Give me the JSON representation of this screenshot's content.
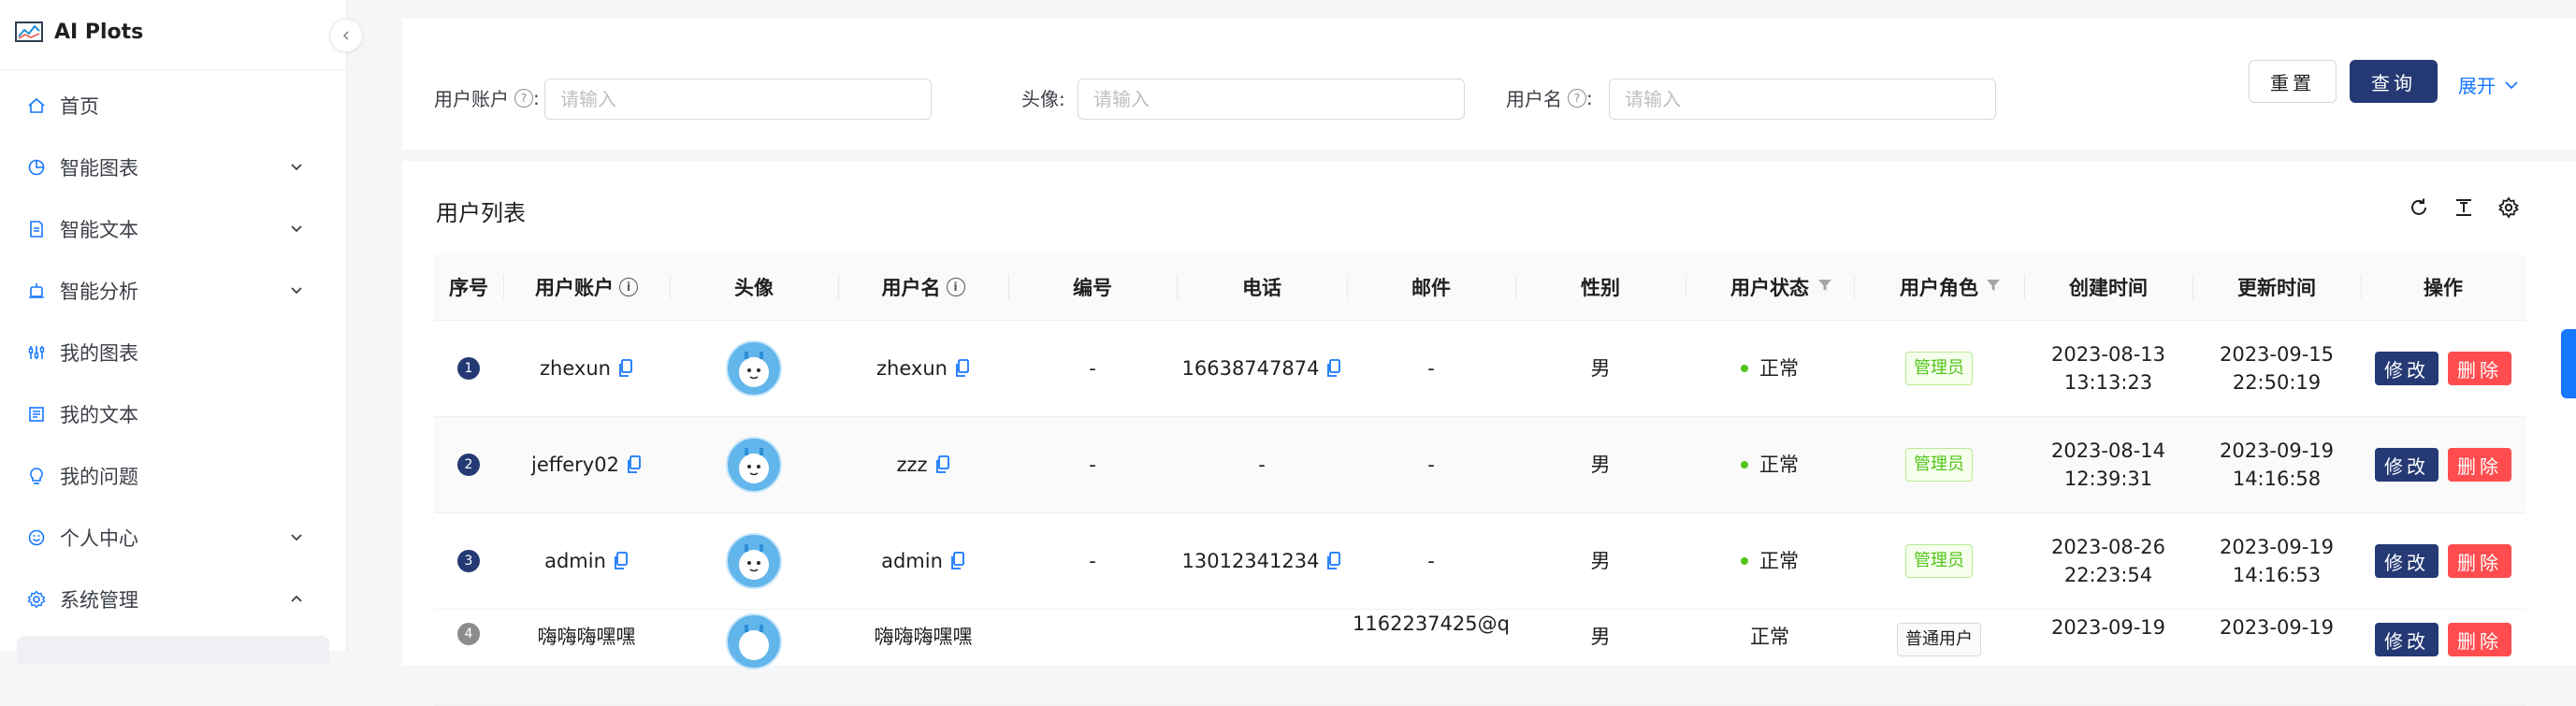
{
  "app": {
    "title": "AI Plots"
  },
  "sidebar": {
    "items": [
      {
        "label": "首页",
        "icon": "home-icon",
        "has_children": false
      },
      {
        "label": "智能图表",
        "icon": "chart-pie-icon",
        "has_children": true,
        "expanded": false
      },
      {
        "label": "智能文本",
        "icon": "file-text-icon",
        "has_children": true,
        "expanded": false
      },
      {
        "label": "智能分析",
        "icon": "bulb-analysis-icon",
        "has_children": true,
        "expanded": false
      },
      {
        "label": "我的图表",
        "icon": "bar-sliders-icon",
        "has_children": false
      },
      {
        "label": "我的文本",
        "icon": "document-icon",
        "has_children": false
      },
      {
        "label": "我的问题",
        "icon": "lightbulb-icon",
        "has_children": false
      },
      {
        "label": "个人中心",
        "icon": "smile-icon",
        "has_children": true,
        "expanded": false
      },
      {
        "label": "系统管理",
        "icon": "gear-icon",
        "has_children": true,
        "expanded": true
      }
    ]
  },
  "filters": {
    "account": {
      "label": "用户账户",
      "placeholder": "请输入",
      "value": ""
    },
    "avatar": {
      "label": "头像:",
      "placeholder": "请输入",
      "value": ""
    },
    "username": {
      "label": "用户名",
      "placeholder": "请输入",
      "value": ""
    },
    "reset_label": "重置",
    "query_label": "查询",
    "expand_label": "展开"
  },
  "table": {
    "title": "用户列表",
    "columns": [
      "序号",
      "用户账户",
      "头像",
      "用户名",
      "编号",
      "电话",
      "邮件",
      "性别",
      "用户状态",
      "用户角色",
      "创建时间",
      "更新时间",
      "操作"
    ],
    "rows": [
      {
        "index": "1",
        "account": "zhexun",
        "username": "zhexun",
        "number": "-",
        "phone": "16638747874",
        "email": "-",
        "gender": "男",
        "status": "正常",
        "role": "管理员",
        "role_type": "admin",
        "created_date": "2023-08-13",
        "created_time": "13:13:23",
        "updated_date": "2023-09-15",
        "updated_time": "22:50:19"
      },
      {
        "index": "2",
        "account": "jeffery02",
        "username": "zzz",
        "number": "-",
        "phone": "-",
        "email": "-",
        "gender": "男",
        "status": "正常",
        "role": "管理员",
        "role_type": "admin",
        "created_date": "2023-08-14",
        "created_time": "12:39:31",
        "updated_date": "2023-09-19",
        "updated_time": "14:16:58"
      },
      {
        "index": "3",
        "account": "admin",
        "username": "admin",
        "number": "-",
        "phone": "13012341234",
        "email": "-",
        "gender": "男",
        "status": "正常",
        "role": "管理员",
        "role_type": "admin",
        "created_date": "2023-08-26",
        "created_time": "22:23:54",
        "updated_date": "2023-09-19",
        "updated_time": "14:16:53"
      },
      {
        "index": "4",
        "account": "嗨嗨嗨嘿嘿",
        "username": "嗨嗨嗨嘿嘿",
        "number": "-",
        "phone": "-",
        "email": "1162237425@q",
        "gender": "男",
        "status": "正常",
        "role": "普通用户",
        "role_type": "user",
        "created_date": "2023-09-19",
        "created_time": "",
        "updated_date": "2023-09-19",
        "updated_time": ""
      }
    ],
    "actions": {
      "edit_label": "修改",
      "delete_label": "删除"
    }
  },
  "colors": {
    "primary": "#253a74",
    "danger": "#ff4d4f",
    "link": "#1677ff",
    "success": "#52c41a"
  }
}
